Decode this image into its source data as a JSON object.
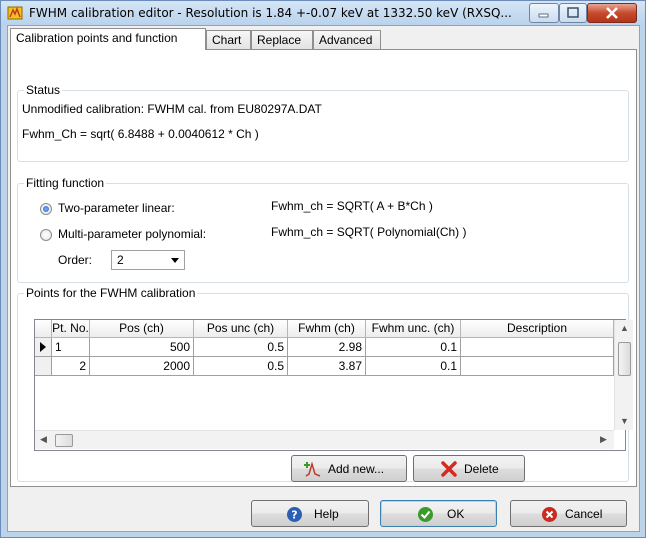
{
  "window": {
    "title": "FWHM calibration editor - Resolution is 1.84 +-0.07 keV at 1332.50 keV (RXSQ...",
    "icon": "calibration-app-icon",
    "controls": [
      "minimize-icon",
      "maximize-icon",
      "close-icon"
    ]
  },
  "tabs": [
    {
      "label": "Calibration points and function",
      "active": true
    },
    {
      "label": "Chart",
      "active": false
    },
    {
      "label": "Replace",
      "active": false
    },
    {
      "label": "Advanced",
      "active": false
    }
  ],
  "status": {
    "title": "Status",
    "line1": "Unmodified calibration: FWHM cal. from EU80297A.DAT",
    "line2": "Fwhm_Ch = sqrt( 6.8488 + 0.0040612 * Ch )"
  },
  "fitting": {
    "title": "Fitting function",
    "options": [
      {
        "label": "Two-parameter linear:",
        "formula": "Fwhm_ch = SQRT( A + B*Ch )",
        "checked": true
      },
      {
        "label": "Multi-parameter polynomial:",
        "formula": "Fwhm_ch = SQRT( Polynomial(Ch) )",
        "checked": false
      }
    ],
    "order_label": "Order:",
    "order_value": "2"
  },
  "points": {
    "title": "Points for the FWHM calibration",
    "columns": [
      "Pt. No.",
      "Pos (ch)",
      "Pos unc (ch)",
      "Fwhm (ch)",
      "Fwhm unc. (ch)",
      "Description"
    ],
    "rows": [
      {
        "pt": "1",
        "pos": "500",
        "pos_unc": "0.5",
        "fwhm": "2.98",
        "fwhm_unc": "0.1",
        "desc": ""
      },
      {
        "pt": "2",
        "pos": "2000",
        "pos_unc": "0.5",
        "fwhm": "3.87",
        "fwhm_unc": "0.1",
        "desc": ""
      }
    ],
    "current_row": 0,
    "add_button": "Add new...",
    "delete_button": "Delete"
  },
  "footer": {
    "help": "Help",
    "ok": "OK",
    "cancel": "Cancel"
  },
  "colors": {
    "titlebar": "#c4d9ef",
    "close_button": "#c74a2c",
    "help_icon": "#2c5fb3",
    "ok_icon": "#3a9a2c",
    "cancel_icon": "#cc2a1f",
    "delete_icon": "#d52b1e"
  }
}
